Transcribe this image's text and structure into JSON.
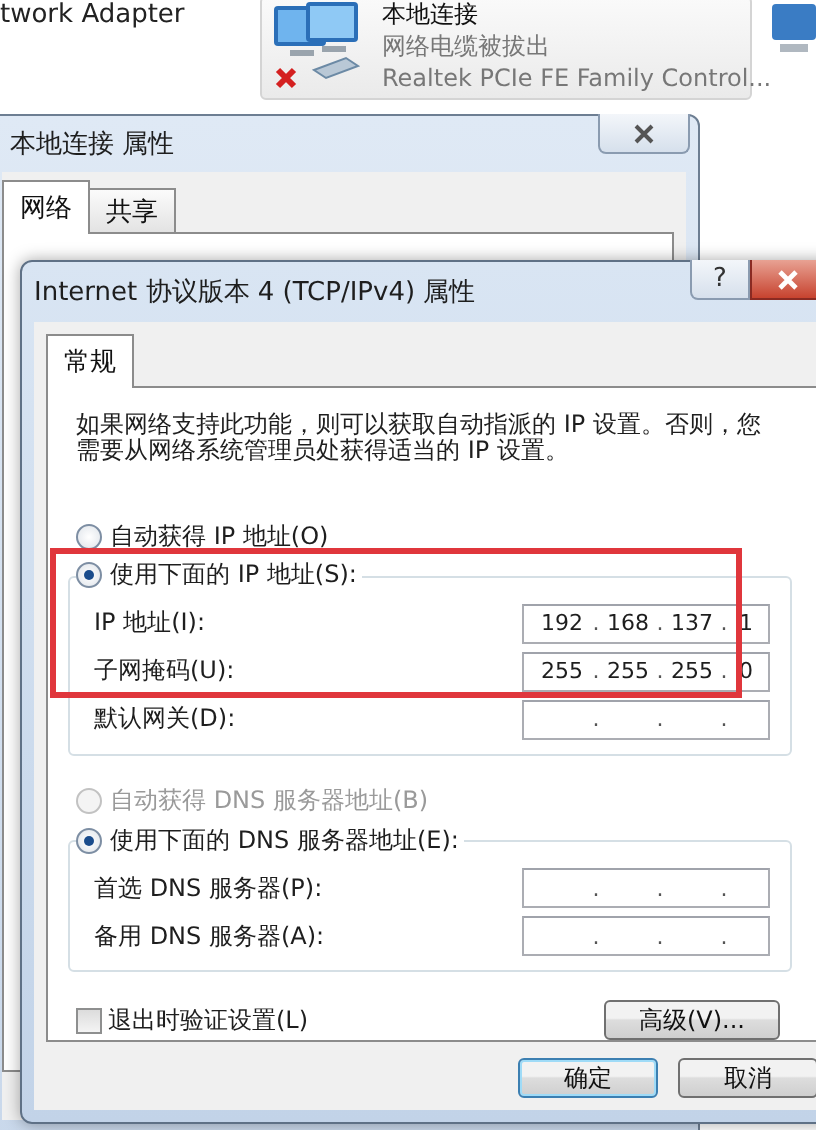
{
  "explorer": {
    "header": "twork Adapter",
    "adapter": {
      "name": "本地连接",
      "status": "网络电缆被拔出",
      "device": "Realtek PCIe FE Family Control...",
      "disconnected": true,
      "selected": true
    }
  },
  "properties_window": {
    "title": "本地连接 属性",
    "tabs": [
      {
        "label": "网络",
        "selected": true
      },
      {
        "label": "共享",
        "selected": false
      }
    ]
  },
  "dialog": {
    "title": "Internet 协议版本 4 (TCP/IPv4) 属性",
    "help": "?",
    "tabs": [
      {
        "label": "常规",
        "selected": true
      }
    ],
    "description": "如果网络支持此功能，则可以获取自动指派的 IP 设置。否则，您需要从网络系统管理员处获得适当的 IP 设置。",
    "auto_ip": {
      "label": "自动获得 IP 地址(O)",
      "selected": false,
      "disabled": false
    },
    "manual_ip": {
      "label": "使用下面的 IP 地址(S):",
      "selected": true,
      "disabled": false
    },
    "ip_fields": [
      {
        "label": "IP 地址(I):",
        "octets": [
          "192",
          "168",
          "137",
          "1"
        ],
        "dots": [
          ".",
          ".",
          "."
        ]
      },
      {
        "label": "子网掩码(U):",
        "octets": [
          "255",
          "255",
          "255",
          "0"
        ],
        "dots": [
          ".",
          ".",
          "."
        ]
      },
      {
        "label": "默认网关(D):",
        "dots": [
          ".",
          ".",
          "."
        ]
      }
    ],
    "auto_dns": {
      "label": "自动获得 DNS 服务器地址(B)",
      "selected": false,
      "disabled": true
    },
    "manual_dns": {
      "label": "使用下面的 DNS 服务器地址(E):",
      "selected": true,
      "disabled": false
    },
    "dns_fields": [
      {
        "label": "首选 DNS 服务器(P):",
        "dots": [
          ".",
          ".",
          "."
        ]
      },
      {
        "label": "备用 DNS 服务器(A):",
        "dots": [
          ".",
          ".",
          "."
        ]
      }
    ],
    "validate": {
      "label": "退出时验证设置(L)",
      "checked": false
    },
    "advanced_button": "高级(V)...",
    "buttons": [
      {
        "label": "确定",
        "default": true
      },
      {
        "label": "取消",
        "default": false
      }
    ]
  },
  "annotations": [
    {
      "kind": "box"
    }
  ]
}
